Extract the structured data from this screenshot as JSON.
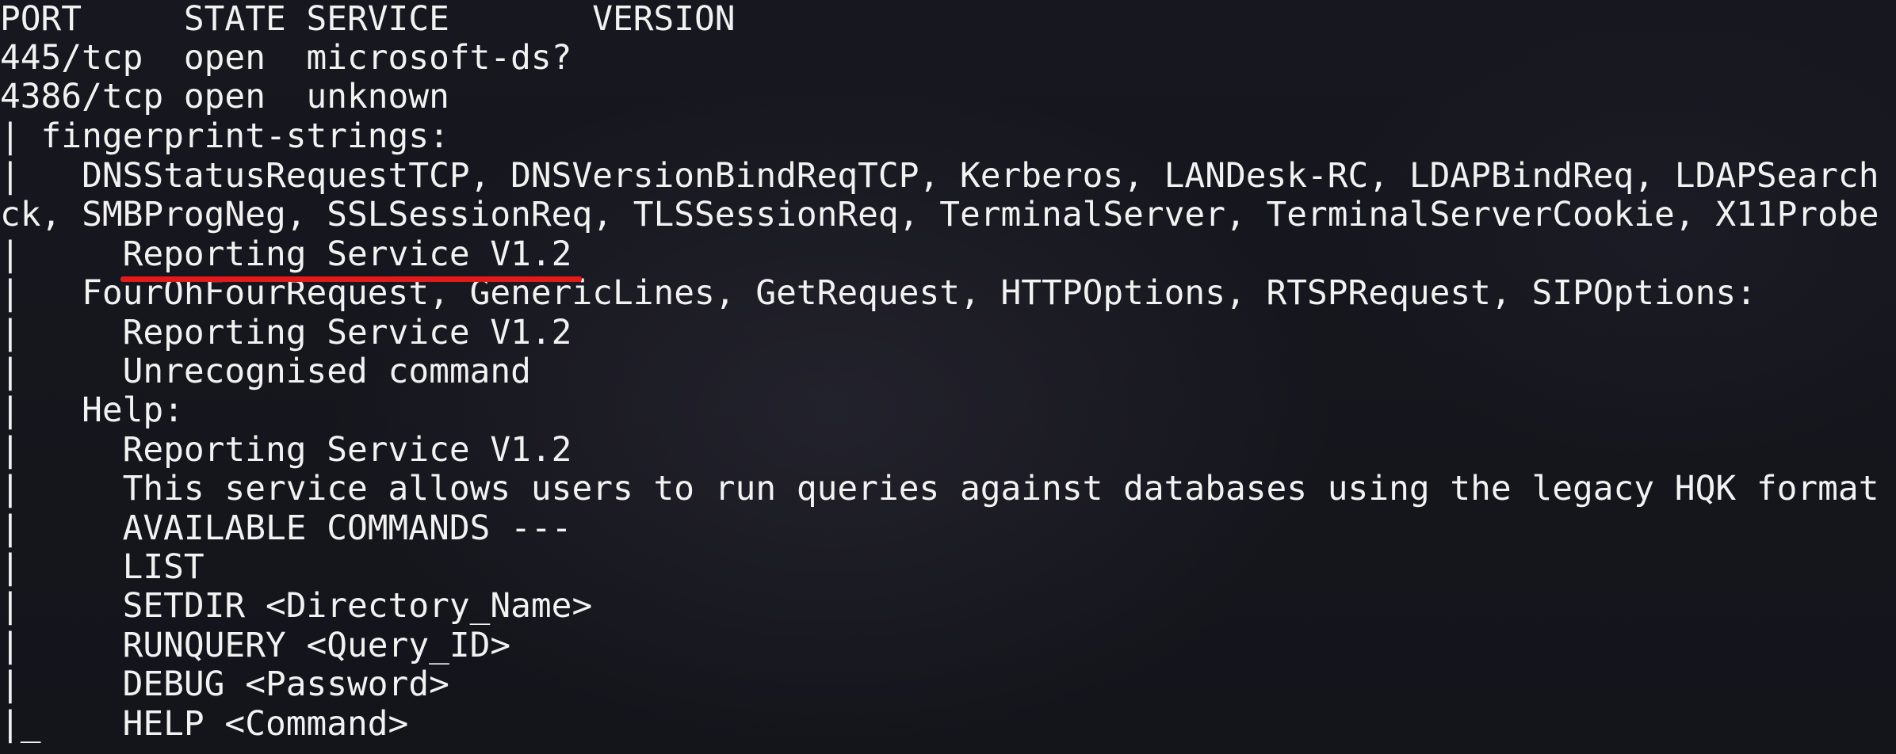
{
  "terminal": {
    "lines": [
      "PORT     STATE SERVICE       VERSION",
      "445/tcp  open  microsoft-ds?",
      "4386/tcp open  unknown",
      "| fingerprint-strings:",
      "|   DNSStatusRequestTCP, DNSVersionBindReqTCP, Kerberos, LANDesk-RC, LDAPBindReq, LDAPSearch",
      "ck, SMBProgNeg, SSLSessionReq, TLSSessionReq, TerminalServer, TerminalServerCookie, X11Probe",
      "|     Reporting Service V1.2",
      "|   FourOhFourRequest, GenericLines, GetRequest, HTTPOptions, RTSPRequest, SIPOptions:",
      "|     Reporting Service V1.2",
      "|     Unrecognised command",
      "|   Help:",
      "|     Reporting Service V1.2",
      "|     This service allows users to run queries against databases using the legacy HQK format",
      "|     AVAILABLE COMMANDS ---",
      "|     LIST",
      "|     SETDIR <Directory_Name>",
      "|     RUNQUERY <Query_ID>",
      "|     DEBUG <Password>",
      "|_    HELP <Command>"
    ]
  },
  "colors": {
    "text": "#f2f2f2",
    "annotation": "#e41a1a",
    "background": "#15151d"
  }
}
